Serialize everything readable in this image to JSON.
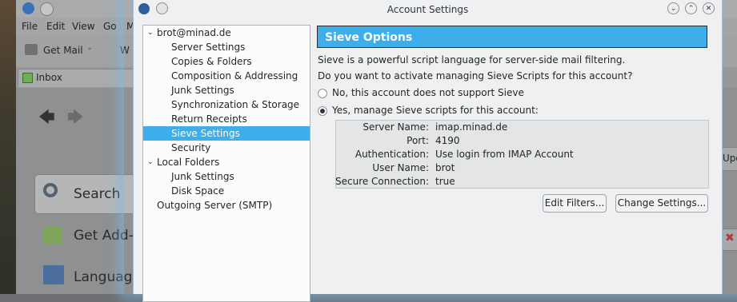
{
  "background_window": {
    "menu": [
      "File",
      "Edit",
      "View",
      "Go",
      "M"
    ],
    "toolbar_get_mail": "Get Mail",
    "toolbar_partial": "W",
    "tab_inbox": "Inbox",
    "search_label": "Search",
    "addons_label": "Get Add-",
    "language_label": "Language",
    "right_partial": "Upd"
  },
  "dialog": {
    "title": "Account Settings",
    "tree": [
      {
        "label": "brot@minad.de",
        "level": 0,
        "expanded": true
      },
      {
        "label": "Server Settings",
        "level": 1
      },
      {
        "label": "Copies & Folders",
        "level": 1
      },
      {
        "label": "Composition & Addressing",
        "level": 1
      },
      {
        "label": "Junk Settings",
        "level": 1
      },
      {
        "label": "Synchronization & Storage",
        "level": 1
      },
      {
        "label": "Return Receipts",
        "level": 1
      },
      {
        "label": "Sieve Settings",
        "level": 1,
        "selected": true
      },
      {
        "label": "Security",
        "level": 1
      },
      {
        "label": "Local Folders",
        "level": 0,
        "expanded": true
      },
      {
        "label": "Junk Settings",
        "level": 1
      },
      {
        "label": "Disk Space",
        "level": 1
      },
      {
        "label": "Outgoing Server (SMTP)",
        "level": 0
      }
    ],
    "header": "Sieve Options",
    "desc1": "Sieve is a powerful script language for server-side mail filtering.",
    "desc2": "Do you want to activate managing Sieve Scripts for this account?",
    "option_no": "No, this account does not support Sieve",
    "option_yes": "Yes, manage Sieve scripts for this account:",
    "selected_option": "yes",
    "info": {
      "server_name_label": "Server Name:",
      "server_name": "imap.minad.de",
      "port_label": "Port:",
      "port": "4190",
      "auth_label": "Authentication:",
      "auth": "Use login from IMAP Account",
      "user_label": "User Name:",
      "user": "brot",
      "secure_label": "Secure Connection:",
      "secure": "true"
    },
    "edit_filters_button": "Edit Filters...",
    "change_settings_button": "Change Settings..."
  },
  "colors": {
    "accent": "#3daee9",
    "window_bg": "#eff0f1"
  }
}
